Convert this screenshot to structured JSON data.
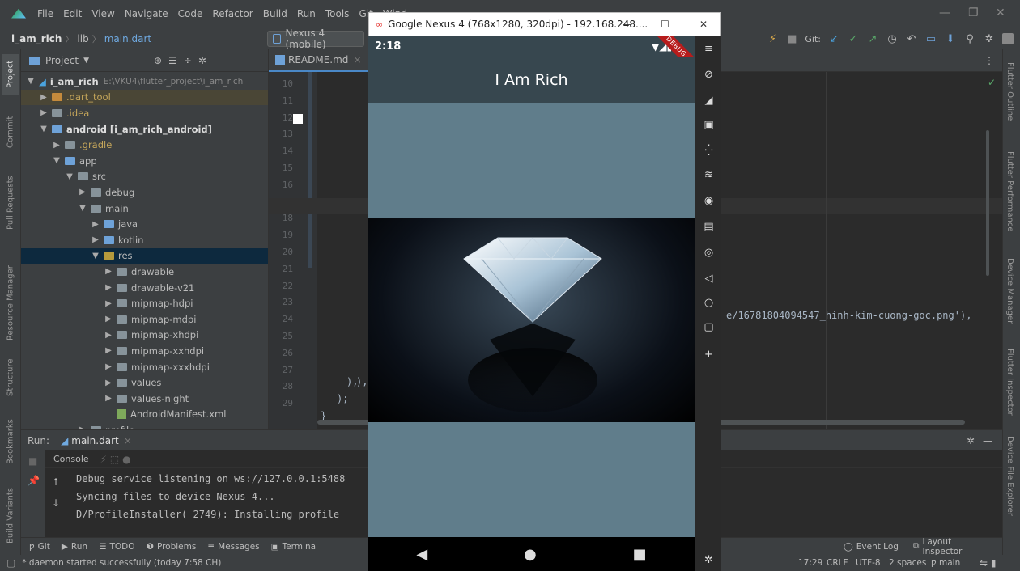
{
  "menubar": {
    "items": [
      "File",
      "Edit",
      "View",
      "Navigate",
      "Code",
      "Refactor",
      "Build",
      "Run",
      "Tools",
      "Git",
      "Wind"
    ]
  },
  "navbar": {
    "project": "i_am_rich",
    "lib": "lib",
    "file": "main.dart",
    "device": "Nexus 4 (mobile)",
    "git_label": "Git:"
  },
  "project_panel": {
    "title": "Project",
    "rows": [
      {
        "label": "i_am_rich",
        "extra": "E:\\VKU4\\flutter_project\\i_am_rich"
      },
      {
        "label": ".dart_tool"
      },
      {
        "label": ".idea"
      },
      {
        "label": "android [i_am_rich_android]"
      },
      {
        "label": ".gradle"
      },
      {
        "label": "app"
      },
      {
        "label": "src"
      },
      {
        "label": "debug"
      },
      {
        "label": "main"
      },
      {
        "label": "java"
      },
      {
        "label": "kotlin"
      },
      {
        "label": "res"
      },
      {
        "label": "drawable"
      },
      {
        "label": "drawable-v21"
      },
      {
        "label": "mipmap-hdpi"
      },
      {
        "label": "mipmap-mdpi"
      },
      {
        "label": "mipmap-xhdpi"
      },
      {
        "label": "mipmap-xxhdpi"
      },
      {
        "label": "mipmap-xxxhdpi"
      },
      {
        "label": "values"
      },
      {
        "label": "values-night"
      },
      {
        "label": "AndroidManifest.xml"
      },
      {
        "label": "profile"
      }
    ]
  },
  "editor": {
    "tab": "README.md",
    "line_numbers": [
      "10",
      "11",
      "12",
      "13",
      "14",
      "15",
      "16",
      "17",
      "18",
      "19",
      "20",
      "21",
      "22",
      "23",
      "24",
      "25",
      "26",
      "27",
      "28",
      "29"
    ],
    "code_fragment": "e/16781804094547_hinh-kim-cuong-goc.png'),",
    "close_paren_1": "),",
    "close_paren_2": "),",
    "close_paren_3": ");",
    "close_brace": "}"
  },
  "run_panel": {
    "label": "Run:",
    "tab": "main.dart",
    "console_tab": "Console",
    "lines": [
      "Debug service listening on ws://127.0.0.1:5488",
      "Syncing files to device Nexus 4...",
      "D/ProfileInstaller( 2749): Installing profile"
    ]
  },
  "bottom_tools": {
    "items": [
      "Git",
      "Run",
      "TODO",
      "Problems",
      "Messages",
      "Terminal"
    ],
    "right": [
      "Event Log",
      "Layout Inspector"
    ]
  },
  "statusbar": {
    "message": "* daemon started successfully (today 7:58 CH)",
    "position": "17:29",
    "line_ending": "CRLF",
    "encoding": "UTF-8",
    "indent": "2 spaces",
    "branch": "main"
  },
  "left_stripe": [
    "Project",
    "Commit",
    "Pull Requests",
    "Resource Manager",
    "Structure",
    "Bookmarks",
    "Build Variants"
  ],
  "right_stripe": [
    "Flutter Outline",
    "Flutter Performance",
    "Device Manager",
    "Flutter Inspector",
    "Device File Explorer"
  ],
  "emulator": {
    "window_title": "Google Nexus 4 (768x1280, 320dpi) - 192.168.248....",
    "time": "2:18",
    "app_title": "I Am Rich",
    "debug": "DEBUG"
  },
  "colors": {
    "ide_bg": "#2b2b2b",
    "panel_bg": "#3c3f41",
    "app_bg": "#607d8b",
    "app_bar": "#37474f",
    "debug_ribbon": "#b71c1c"
  }
}
